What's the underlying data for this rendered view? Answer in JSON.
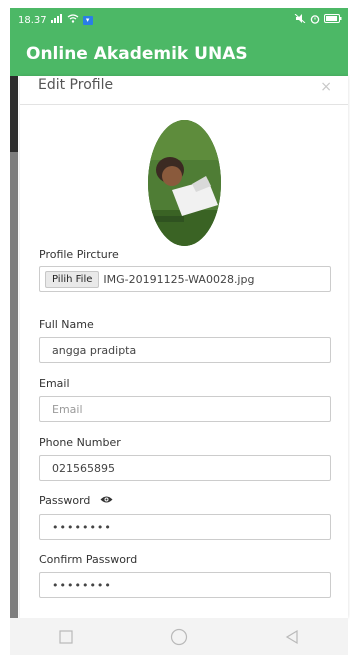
{
  "status_bar": {
    "time": "18.37",
    "network_icon": "signal-icon",
    "wifi_icon": "wifi-icon",
    "right_icons": [
      "mute-icon",
      "alarm-icon",
      "battery-icon"
    ]
  },
  "app_bar": {
    "title": "Online Akademik UNAS"
  },
  "modal": {
    "title": "Edit Profile",
    "close_label": "×",
    "profile_picture_label": "Profile Pircture",
    "file_button_label": "Pilih File",
    "file_name": "IMG-20191125-WA0028.jpg",
    "full_name_label": "Full Name",
    "full_name_value": "angga pradipta",
    "email_label": "Email",
    "email_placeholder": "Email",
    "phone_label": "Phone Number",
    "phone_value": "021565895",
    "password_label": "Password",
    "password_value": "••••••••",
    "confirm_password_label": "Confirm Password",
    "confirm_password_value": "••••••••"
  },
  "nav_bar": {
    "buttons": [
      "recents-square-icon",
      "home-circle-icon",
      "back-triangle-icon"
    ]
  },
  "colors": {
    "brand": "#4cb866",
    "nav_bg": "#f3f3f3"
  }
}
